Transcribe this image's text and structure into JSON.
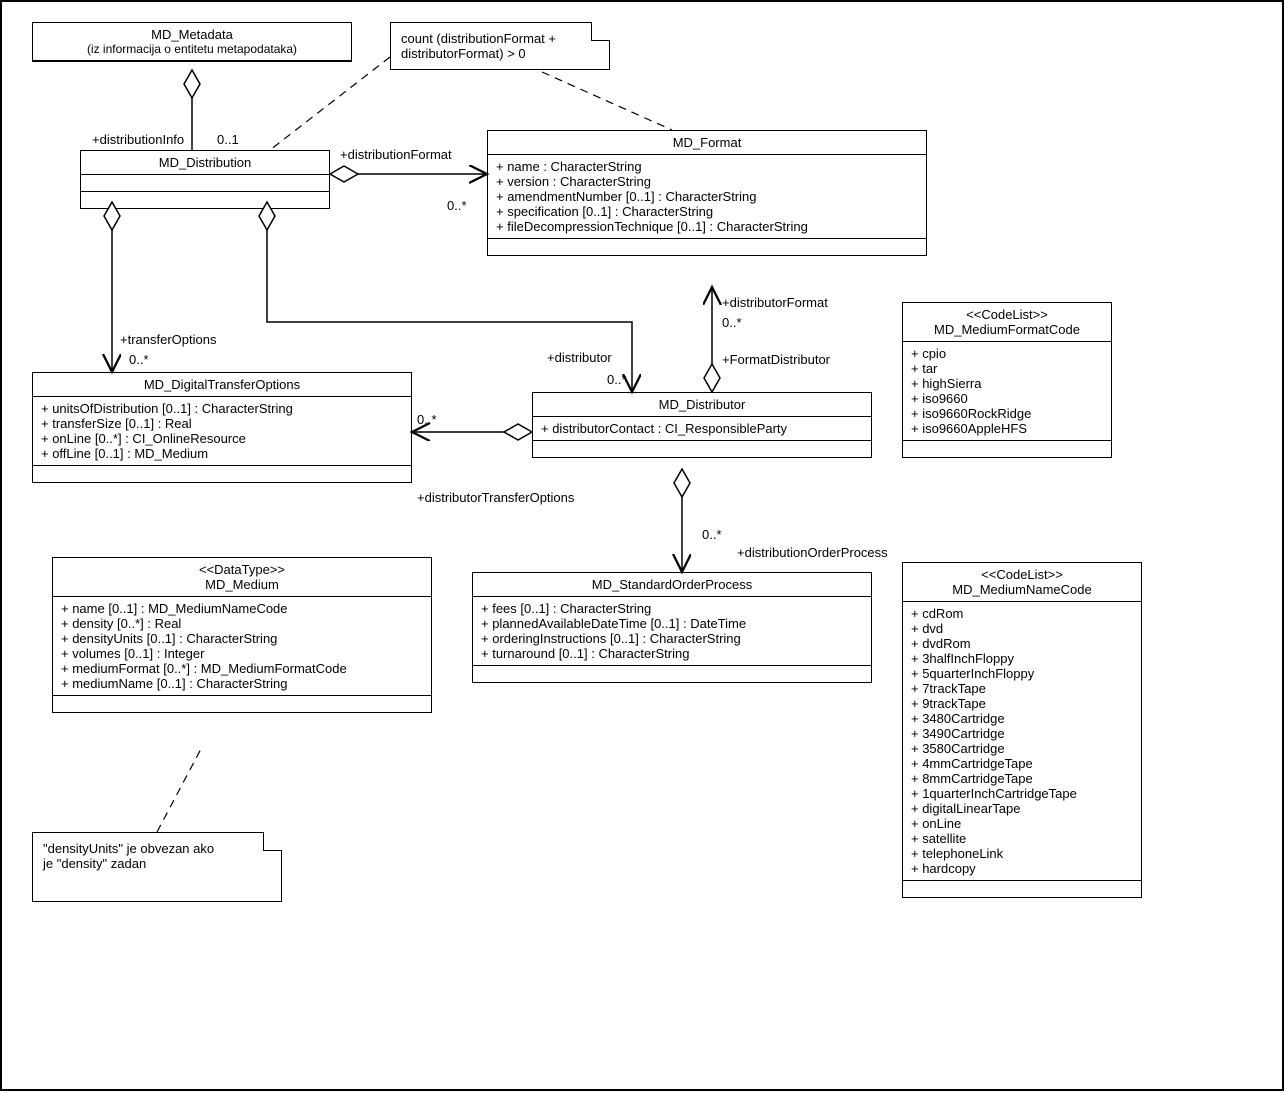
{
  "classes": {
    "metadata": {
      "name": "MD_Metadata",
      "subtitle": "(iz informacija o entitetu metapodataka)"
    },
    "distribution": {
      "name": "MD_Distribution"
    },
    "format": {
      "name": "MD_Format",
      "attrs": [
        "+ name : CharacterString",
        "+ version : CharacterString",
        "+ amendmentNumber [0..1] : CharacterString",
        "+ specification [0..1] : CharacterString",
        "+ fileDecompressionTechnique [0..1] : CharacterString"
      ]
    },
    "dto": {
      "name": "MD_DigitalTransferOptions",
      "attrs": [
        "+ unitsOfDistribution [0..1] : CharacterString",
        "+ transferSize [0..1] : Real",
        "+ onLine [0..*] : CI_OnlineResource",
        "+ offLine [0..1] : MD_Medium"
      ]
    },
    "distributor": {
      "name": "MD_Distributor",
      "attrs": [
        "+ distributorContact : CI_ResponsibleParty"
      ]
    },
    "sop": {
      "name": "MD_StandardOrderProcess",
      "attrs": [
        "+ fees [0..1] : CharacterString",
        "+ plannedAvailableDateTime [0..1] : DateTime",
        "+ orderingInstructions [0..1] : CharacterString",
        "+ turnaround [0..1] : CharacterString"
      ]
    },
    "medium": {
      "stereo": "<<DataType>>",
      "name": "MD_Medium",
      "attrs": [
        "+ name [0..1] : MD_MediumNameCode",
        "+ density [0..*] : Real",
        "+ densityUnits [0..1] : CharacterString",
        "+ volumes [0..1] : Integer",
        "+ mediumFormat [0..*] : MD_MediumFormatCode",
        "+ mediumName [0..1] : CharacterString"
      ]
    },
    "mfc": {
      "stereo": "<<CodeList>>",
      "name": "MD_MediumFormatCode",
      "attrs": [
        "+ cpio",
        "+ tar",
        "+ highSierra",
        "+ iso9660",
        "+ iso9660RockRidge",
        "+ iso9660AppleHFS"
      ]
    },
    "mnc": {
      "stereo": "<<CodeList>>",
      "name": "MD_MediumNameCode",
      "attrs": [
        "+ cdRom",
        "+ dvd",
        "+ dvdRom",
        "+ 3halfInchFloppy",
        "+ 5quarterInchFloppy",
        "+ 7trackTape",
        "+ 9trackTape",
        "+ 3480Cartridge",
        "+ 3490Cartridge",
        "+ 3580Cartridge",
        "+ 4mmCartridgeTape",
        "+ 8mmCartridgeTape",
        "+ 1quarterInchCartridgeTape",
        "+ digitalLinearTape",
        "+ onLine",
        "+ satellite",
        "+ telephoneLink",
        "+ hardcopy"
      ]
    }
  },
  "notes": {
    "constraint": "count (distributionFormat +\ndistributorFormat) > 0",
    "density": "\"densityUnits\" je obvezan ako\nje \"density\" zadan"
  },
  "labels": {
    "distributionInfo": "+distributionInfo",
    "distributionInfoMult": "0..1",
    "distributionFormat": "+distributionFormat",
    "distributionFormatMult": "0..*",
    "transferOptions": "+transferOptions",
    "transferOptionsMult": "0..*",
    "distributor": "+distributor",
    "distributorMult": "0..*",
    "distributorFormat": "+distributorFormat",
    "distributorFormatMult": "0..*",
    "formatDistributor": "+FormatDistributor",
    "distributorTransferOptions": "+distributorTransferOptions",
    "distributorTransferOptionsMult": "0..*",
    "distributionOrderProcess": "+distributionOrderProcess",
    "distributionOrderProcessMult": "0..*"
  }
}
